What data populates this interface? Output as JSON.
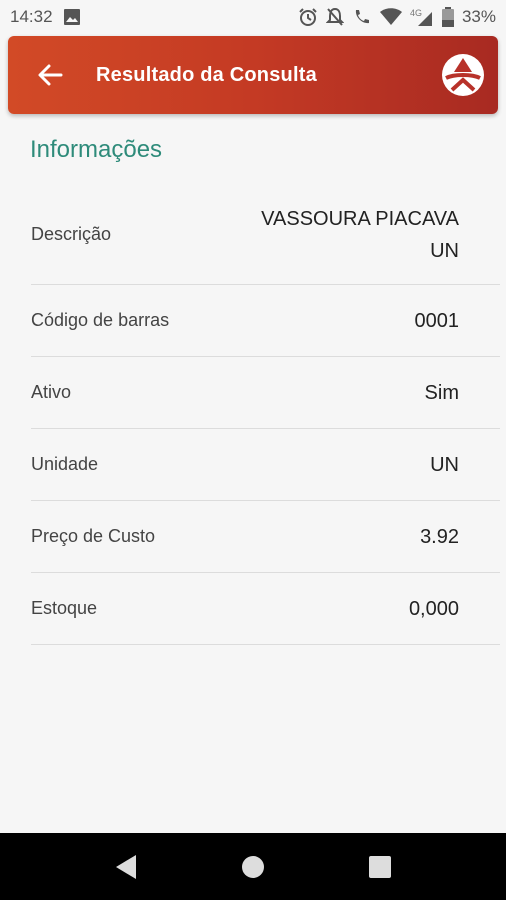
{
  "status_bar": {
    "time": "14:32",
    "battery": "33%",
    "network": "4G"
  },
  "app_bar": {
    "title": "Resultado da Consulta",
    "color_left": "#d24a26",
    "color_right": "#a82a22"
  },
  "section": {
    "title": "Informações",
    "title_color": "#2e8b7a"
  },
  "rows": [
    {
      "label": "Descrição",
      "value_line1": "VASSOURA PIACAVA",
      "value_line2": "UN"
    },
    {
      "label": "Código de barras",
      "value": "0001"
    },
    {
      "label": "Ativo",
      "value": "Sim"
    },
    {
      "label": "Unidade",
      "value": "UN"
    },
    {
      "label": "Preço de Custo",
      "value": "3.92"
    },
    {
      "label": "Estoque",
      "value": "0,000"
    }
  ]
}
